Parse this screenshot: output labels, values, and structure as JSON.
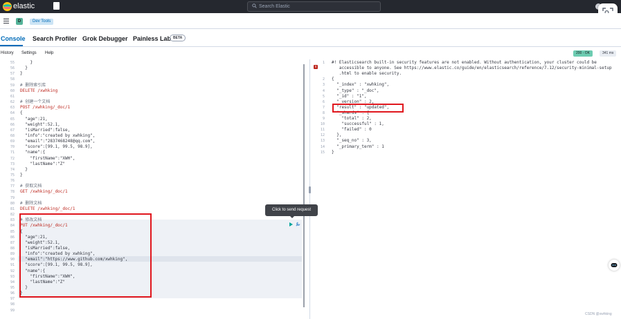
{
  "header": {
    "brand": "elastic",
    "search_placeholder": "Search Elastic"
  },
  "breadcrumb": {
    "avatar_letter": "D",
    "current": "Dev Tools"
  },
  "tabs": [
    {
      "label": "Console",
      "active": true
    },
    {
      "label": "Search Profiler",
      "active": false
    },
    {
      "label": "Grok Debugger",
      "active": false
    },
    {
      "label": "Painless Lab",
      "active": false
    }
  ],
  "beta_label": "BETA",
  "submenu": [
    "History",
    "Settings",
    "Help"
  ],
  "response": {
    "status": "200 - OK",
    "time": "341 ms"
  },
  "tooltip": "Click to send request",
  "watermark": "CSDN @xwhking",
  "editor_lines": [
    {
      "n": "55",
      "t": "    }"
    },
    {
      "n": "56",
      "t": "  }"
    },
    {
      "n": "57",
      "t": "}"
    },
    {
      "n": "58",
      "t": ""
    },
    {
      "n": "59",
      "t": "# 删除索引库"
    },
    {
      "n": "60",
      "t": "DELETE /xwhking"
    },
    {
      "n": "61",
      "t": ""
    },
    {
      "n": "62",
      "t": "# 创建一个文档"
    },
    {
      "n": "63",
      "t": "POST /xwhking/_doc/1"
    },
    {
      "n": "64",
      "t": "{"
    },
    {
      "n": "65",
      "t": "  \"age\":21,"
    },
    {
      "n": "66",
      "t": "  \"weight\":52.1,"
    },
    {
      "n": "67",
      "t": "  \"isMarried\":false,"
    },
    {
      "n": "68",
      "t": "  \"info\":\"created by xwhking\","
    },
    {
      "n": "69",
      "t": "  \"email\":\"2837468248@qq.com\","
    },
    {
      "n": "70",
      "t": "  \"score\":[99.1, 99.5, 98.9],"
    },
    {
      "n": "71",
      "t": "  \"name\":{"
    },
    {
      "n": "72",
      "t": "    \"firstName\":\"XWH\","
    },
    {
      "n": "73",
      "t": "    \"lastName\":\"Z\""
    },
    {
      "n": "74",
      "t": "  }"
    },
    {
      "n": "75",
      "t": "}"
    },
    {
      "n": "76",
      "t": ""
    },
    {
      "n": "77",
      "t": "# 获取文档"
    },
    {
      "n": "78",
      "t": "GET /xwhking/_doc/1"
    },
    {
      "n": "79",
      "t": ""
    },
    {
      "n": "80",
      "t": "# 删除文档"
    },
    {
      "n": "81",
      "t": "DELETE /xwhking/_doc/1"
    },
    {
      "n": "82",
      "t": ""
    },
    {
      "n": "83",
      "t": "# 修改文档"
    },
    {
      "n": "84",
      "t": "PUT /xwhking/_doc/1"
    },
    {
      "n": "85",
      "t": "{"
    },
    {
      "n": "86",
      "t": "  \"age\":21,"
    },
    {
      "n": "87",
      "t": "  \"weight\":52.1,"
    },
    {
      "n": "88",
      "t": "  \"isMarried\":false,"
    },
    {
      "n": "89",
      "t": "  \"info\":\"created by xwhking\","
    },
    {
      "n": "90",
      "t": "  \"email\":\"https://www.github.com/xwhking\","
    },
    {
      "n": "91",
      "t": "  \"score\":[99.1, 99.5, 98.9],"
    },
    {
      "n": "92",
      "t": "  \"name\":{"
    },
    {
      "n": "93",
      "t": "    \"firstName\":\"XWH\","
    },
    {
      "n": "94",
      "t": "    \"lastName\":\"Z\""
    },
    {
      "n": "95",
      "t": "  }"
    },
    {
      "n": "96",
      "t": "}"
    },
    {
      "n": "97",
      "t": ""
    },
    {
      "n": "98",
      "t": ""
    },
    {
      "n": "99",
      "t": ""
    }
  ],
  "output_lines": [
    {
      "n": "1",
      "t": "#! Elasticsearch built-in security features are not enabled. Without authentication, your cluster could be"
    },
    {
      "n": "",
      "t": "   accessible to anyone. See https://www.elastic.co/guide/en/elasticsearch/reference/7.12/security-minimal-setup"
    },
    {
      "n": "",
      "t": "   .html to enable security."
    },
    {
      "n": "2",
      "t": "{"
    },
    {
      "n": "3",
      "t": "  \"_index\" : \"xwhking\","
    },
    {
      "n": "4",
      "t": "  \"_type\" : \"_doc\","
    },
    {
      "n": "5",
      "t": "  \"_id\" : \"1\","
    },
    {
      "n": "6",
      "t": "  \"_version\" : 2,"
    },
    {
      "n": "7",
      "t": "  \"result\" : \"updated\","
    },
    {
      "n": "8",
      "t": "  \"_shards\" : {"
    },
    {
      "n": "9",
      "t": "    \"total\" : 2,"
    },
    {
      "n": "10",
      "t": "    \"successful\" : 1,"
    },
    {
      "n": "11",
      "t": "    \"failed\" : 0"
    },
    {
      "n": "12",
      "t": "  },"
    },
    {
      "n": "13",
      "t": "  \"_seq_no\" : 3,"
    },
    {
      "n": "14",
      "t": "  \"_primary_term\" : 1"
    },
    {
      "n": "15",
      "t": "}"
    }
  ]
}
